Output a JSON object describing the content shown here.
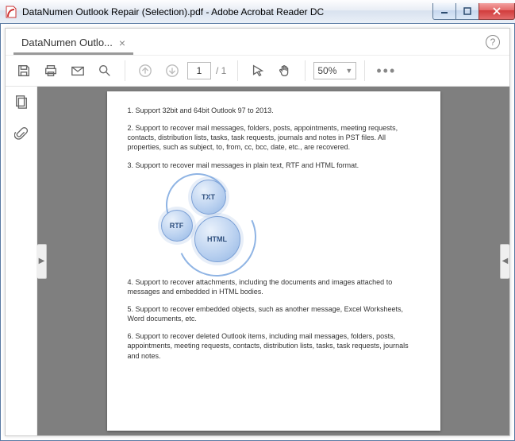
{
  "window": {
    "title": "DataNumen Outlook Repair (Selection).pdf - Adobe Acrobat Reader DC"
  },
  "tabs": {
    "active": {
      "label": "DataNumen Outlo..."
    }
  },
  "toolbar": {
    "page_current": "1",
    "page_total": "/ 1",
    "zoom": "50%"
  },
  "document": {
    "paragraphs": {
      "p1": "1. Support 32bit and 64bit Outlook 97 to 2013.",
      "p2": "2. Support to recover mail messages, folders, posts, appointments, meeting requests, contacts, distribution lists, tasks, task requests, journals and notes in PST files. All properties, such as subject, to, from, cc, bcc, date, etc., are recovered.",
      "p3": "3. Support to recover mail messages in plain text, RTF and HTML format.",
      "p4": "4. Support to recover attachments, including the documents and images attached to messages and embedded in HTML bodies.",
      "p5": "5. Support to recover embedded objects, such as another message, Excel Worksheets, Word documents, etc.",
      "p6": "6. Support to recover deleted Outlook items, including mail messages, folders, posts, appointments, meeting requests, contacts, distribution lists, tasks, task requests, journals and notes."
    },
    "gears": {
      "txt": "TXT",
      "rtf": "RTF",
      "html": "HTML"
    }
  }
}
